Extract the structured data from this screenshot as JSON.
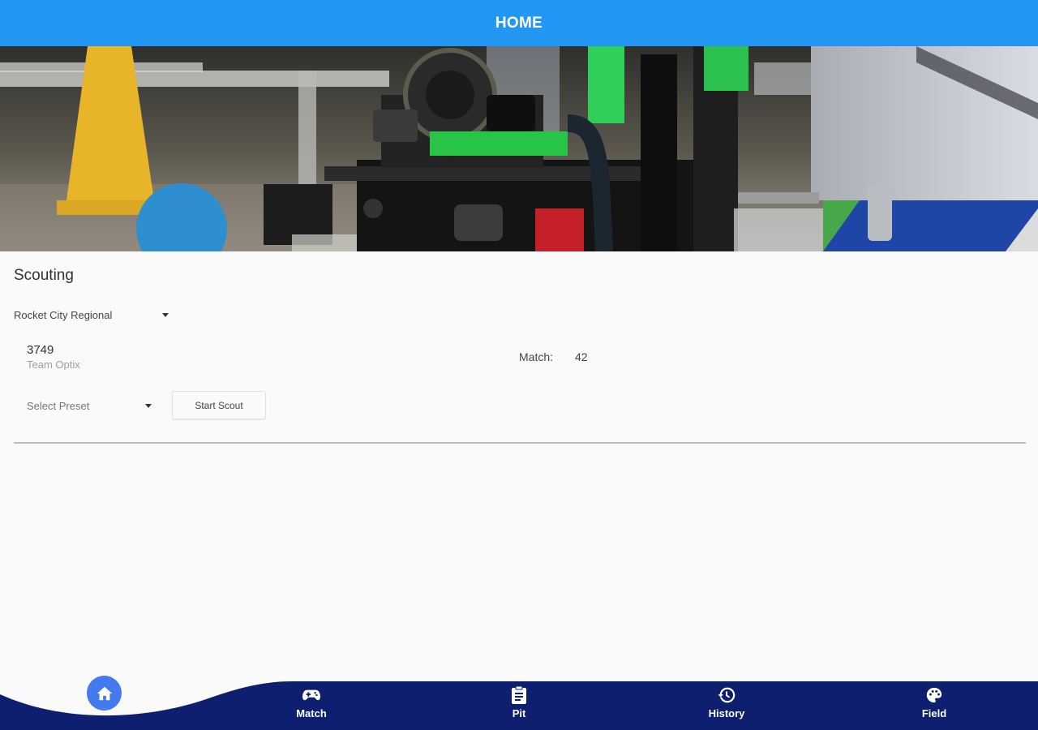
{
  "app_bar": {
    "title": "HOME"
  },
  "scouting": {
    "title": "Scouting",
    "event": "Rocket City Regional",
    "team_number": "3749",
    "team_name": "Team Optix",
    "match_label": "Match:",
    "match_value": "42",
    "preset_placeholder": "Select Preset",
    "start_button": "Start Scout"
  },
  "bottom_nav": {
    "items": [
      {
        "label": "Match",
        "icon": "gamepad-icon"
      },
      {
        "label": "Pit",
        "icon": "clipboard-icon"
      },
      {
        "label": "History",
        "icon": "history-icon"
      },
      {
        "label": "Field",
        "icon": "palette-icon"
      }
    ],
    "active": "home-icon"
  },
  "colors": {
    "app_bar": "#2196f3",
    "bottom_nav": "#0d1f6e",
    "home_fab": "#4479ef"
  }
}
